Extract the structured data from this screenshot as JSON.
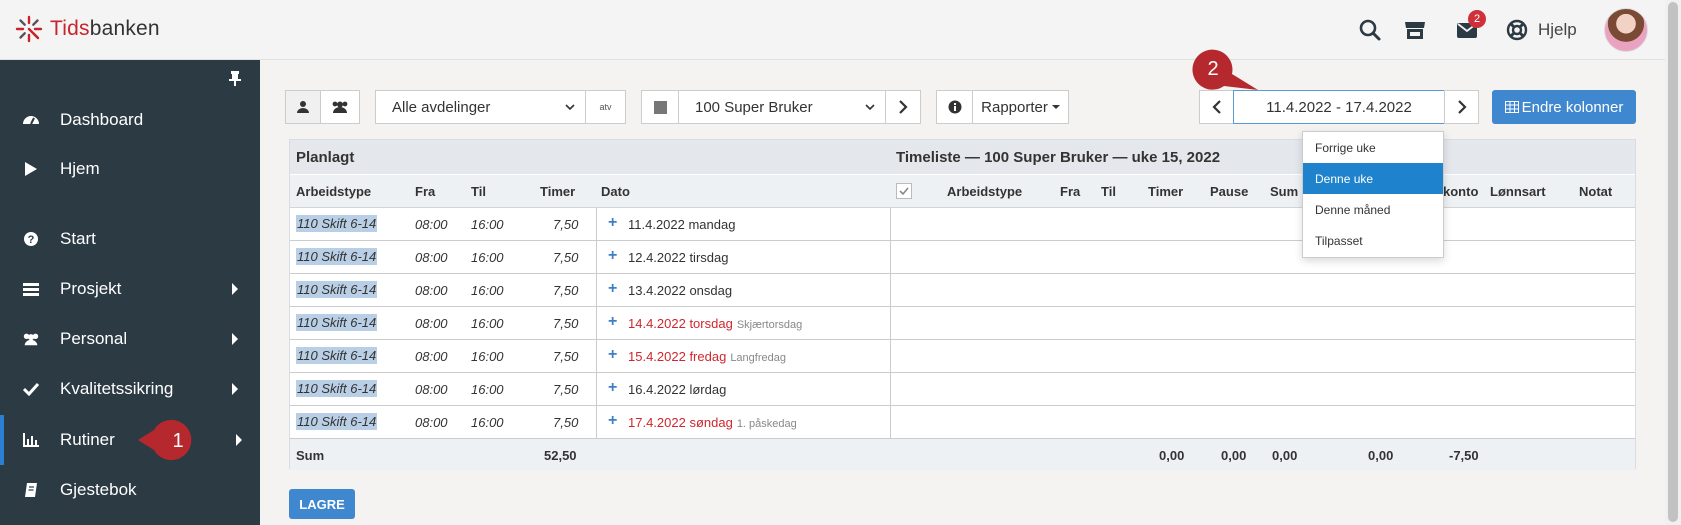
{
  "brand": {
    "part1": "Tids",
    "part2": "banken"
  },
  "topbar": {
    "help_label": "Hjelp",
    "mail_count": "2"
  },
  "sidebar": {
    "items": [
      {
        "label": "Dashboard",
        "icon": "dashboard-icon",
        "has_arrow": false
      },
      {
        "label": "Hjem",
        "icon": "play-icon",
        "has_arrow": false
      },
      {
        "label": "Start",
        "icon": "question-icon",
        "has_arrow": false
      },
      {
        "label": "Prosjekt",
        "icon": "list-icon",
        "has_arrow": true
      },
      {
        "label": "Personal",
        "icon": "users-icon",
        "has_arrow": true
      },
      {
        "label": "Kvalitetssikring",
        "icon": "check-icon",
        "has_arrow": true
      },
      {
        "label": "Rutiner",
        "icon": "bar-chart-icon",
        "has_arrow": true,
        "active": true
      },
      {
        "label": "Gjestebok",
        "icon": "book-icon",
        "has_arrow": false
      }
    ]
  },
  "callouts": {
    "one": "1",
    "two": "2"
  },
  "toolbar": {
    "department_select": "Alle avdelinger",
    "atv_label": "atv",
    "user_select": "100 Super Bruker",
    "reports_label": "Rapporter",
    "date_range": "11.4.2022 - 17.4.2022",
    "endre_label": "Endre kolonner"
  },
  "date_dropdown": {
    "options": [
      "Forrige uke",
      "Denne uke",
      "Denne måned",
      "Tilpasset"
    ],
    "selected": "Denne uke"
  },
  "table": {
    "planned_title": "Planlagt",
    "timesheet_title": "Timeliste — 100 Super Bruker — uke 15, 2022",
    "left_headers": {
      "arbeidstype": "Arbeidstype",
      "fra": "Fra",
      "til": "Til",
      "timer": "Timer",
      "dato": "Dato"
    },
    "right_headers": {
      "arbeidstype": "Arbeidstype",
      "fra": "Fra",
      "til": "Til",
      "timer": "Timer",
      "pause": "Pause",
      "sum": "Sum",
      "konto": "konto",
      "lonnsart": "Lønnsart",
      "notat": "Notat"
    },
    "rows": [
      {
        "type": "110 Skift 6-14",
        "fra": "08:00",
        "til": "16:00",
        "timer": "7,50",
        "dato": "11.4.2022 mandag",
        "holiday": false,
        "note": ""
      },
      {
        "type": "110 Skift 6-14",
        "fra": "08:00",
        "til": "16:00",
        "timer": "7,50",
        "dato": "12.4.2022 tirsdag",
        "holiday": false,
        "note": ""
      },
      {
        "type": "110 Skift 6-14",
        "fra": "08:00",
        "til": "16:00",
        "timer": "7,50",
        "dato": "13.4.2022 onsdag",
        "holiday": false,
        "note": ""
      },
      {
        "type": "110 Skift 6-14",
        "fra": "08:00",
        "til": "16:00",
        "timer": "7,50",
        "dato": "14.4.2022 torsdag",
        "holiday": true,
        "note": "Skjærtorsdag"
      },
      {
        "type": "110 Skift 6-14",
        "fra": "08:00",
        "til": "16:00",
        "timer": "7,50",
        "dato": "15.4.2022 fredag",
        "holiday": true,
        "note": "Langfredag"
      },
      {
        "type": "110 Skift 6-14",
        "fra": "08:00",
        "til": "16:00",
        "timer": "7,50",
        "dato": "16.4.2022 lørdag",
        "holiday": false,
        "note": ""
      },
      {
        "type": "110 Skift 6-14",
        "fra": "08:00",
        "til": "16:00",
        "timer": "7,50",
        "dato": "17.4.2022 søndag",
        "holiday": true,
        "note": "1. påskedag"
      }
    ],
    "sum": {
      "label": "Sum",
      "planned_timer": "52,50",
      "timer": "0,00",
      "pause": "0,00",
      "sum": "0,00",
      "col_a": "0,00",
      "konto": "-7,50"
    }
  },
  "save_label": "LAGRE",
  "colors": {
    "sidebar": "#2c3a44",
    "accent": "#3f88cf",
    "holiday": "#d0262d",
    "callout": "#b5282e"
  }
}
